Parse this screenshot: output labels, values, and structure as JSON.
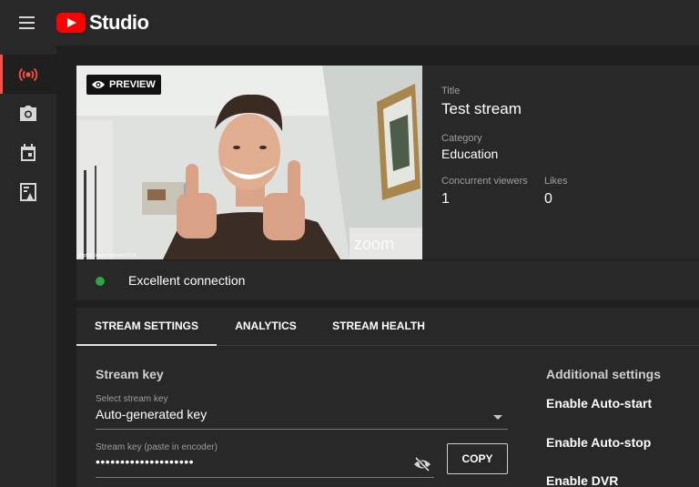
{
  "app": {
    "logo_text": "Studio"
  },
  "preview": {
    "badge": "PREVIEW",
    "video_watermark": "zoom",
    "video_caption": "Digital Culture Network DCN"
  },
  "stream_info": {
    "title_label": "Title",
    "title_value": "Test stream",
    "category_label": "Category",
    "category_value": "Education",
    "viewers_label": "Concurrent viewers",
    "viewers_value": "1",
    "likes_label": "Likes",
    "likes_value": "0"
  },
  "connection": {
    "status": "Excellent connection",
    "status_color": "#2ba640"
  },
  "tabs": [
    {
      "label": "STREAM SETTINGS",
      "active": true
    },
    {
      "label": "ANALYTICS",
      "active": false
    },
    {
      "label": "STREAM HEALTH",
      "active": false
    }
  ],
  "stream_key": {
    "section_title": "Stream key",
    "select_label": "Select stream key",
    "select_value": "Auto-generated key",
    "key_label": "Stream key (paste in encoder)",
    "key_value": "••••••••••••••••••••",
    "copy_label": "COPY"
  },
  "additional": {
    "section_title": "Additional settings",
    "items": [
      "Enable Auto-start",
      "Enable Auto-stop",
      "Enable DVR"
    ]
  },
  "rail": {
    "items": [
      {
        "icon": "live-broadcast-icon",
        "active": true
      },
      {
        "icon": "camera-icon",
        "active": false
      },
      {
        "icon": "calendar-icon",
        "active": false
      },
      {
        "icon": "content-icon",
        "active": false
      }
    ]
  },
  "colors": {
    "accent_red": "#ff0000",
    "active_indicator": "#ff4e45",
    "background": "#1f1f1f",
    "panel": "#282828"
  }
}
